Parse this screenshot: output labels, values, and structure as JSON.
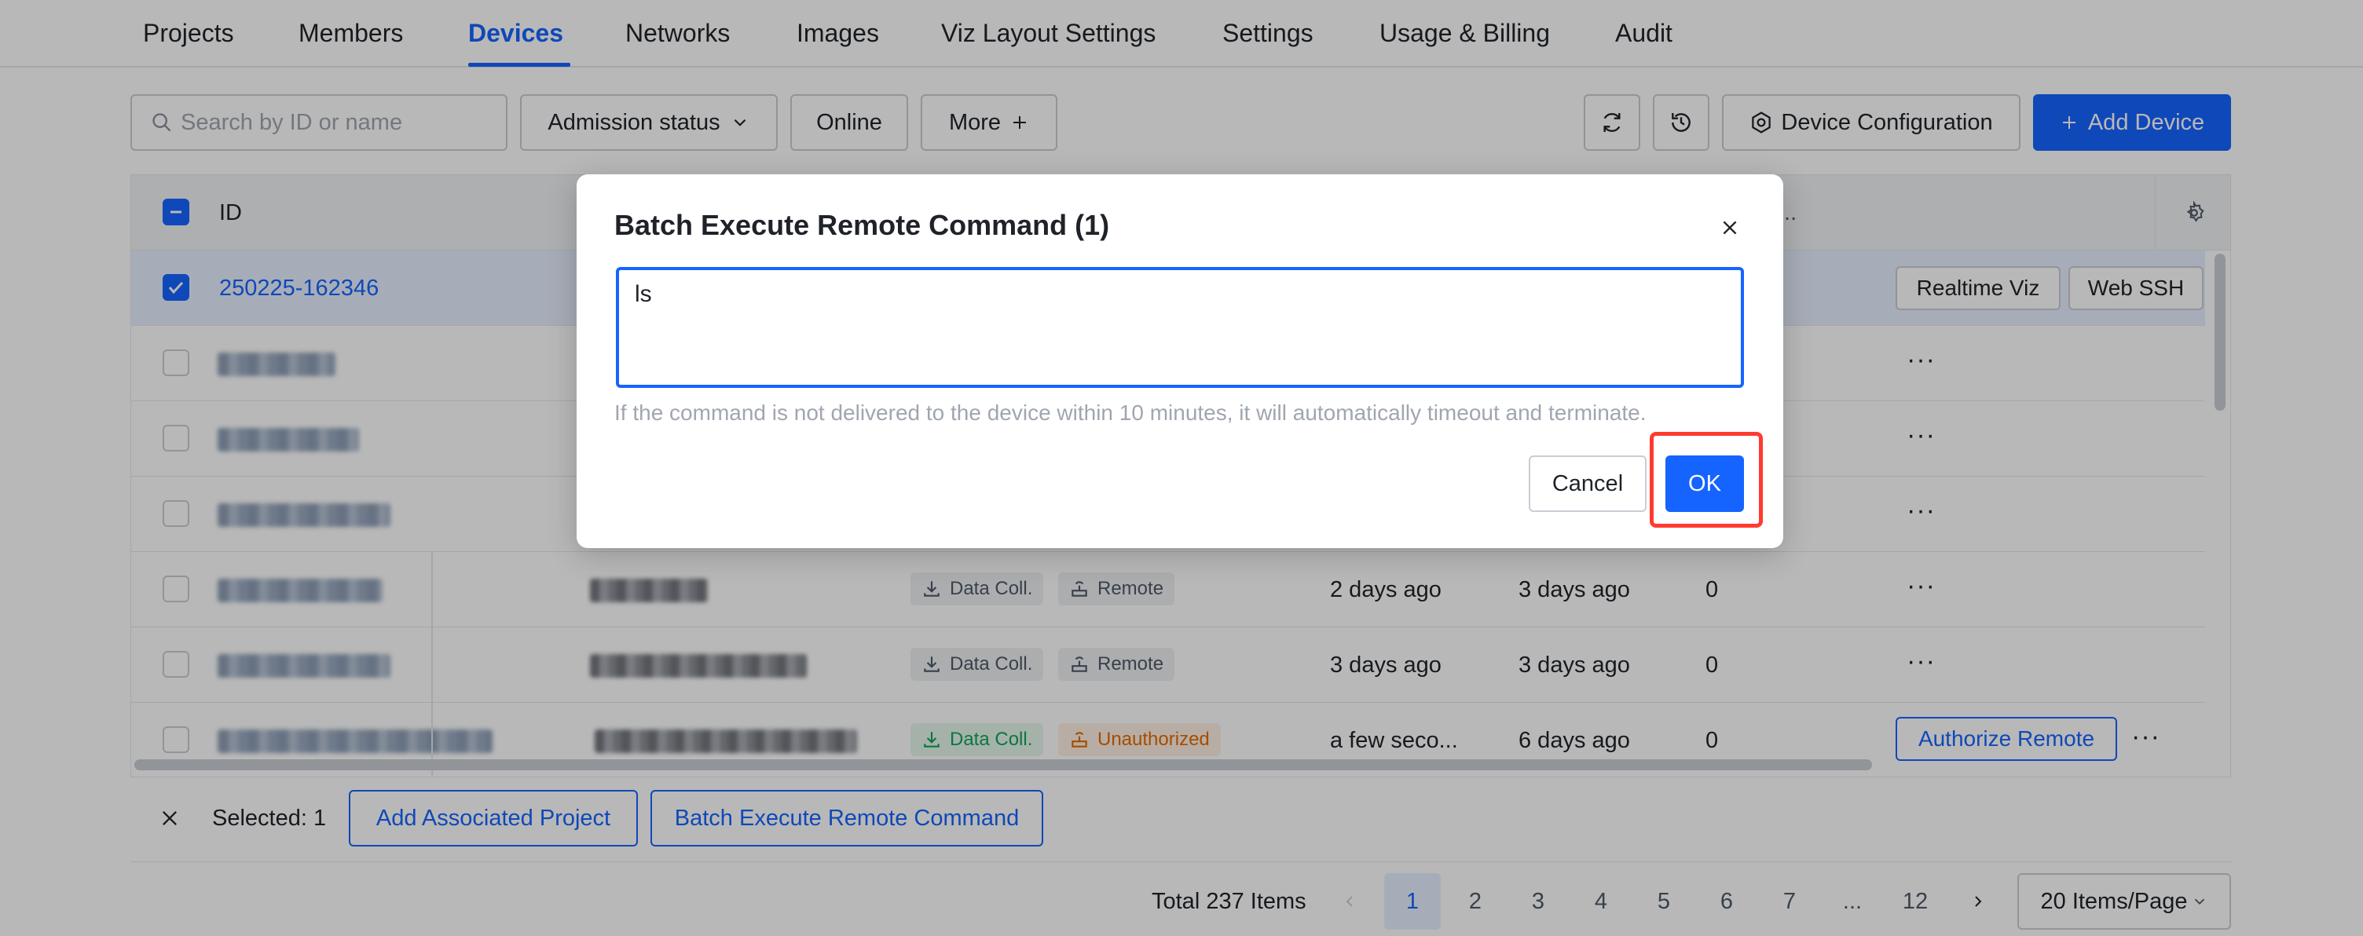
{
  "nav": {
    "tabs": [
      "Projects",
      "Members",
      "Devices",
      "Networks",
      "Images",
      "Viz Layout Settings",
      "Settings",
      "Usage & Billing",
      "Audit"
    ],
    "active_tab": "Devices"
  },
  "toolbar": {
    "search_placeholder": "Search by ID or name",
    "admission_status_label": "Admission status",
    "online_label": "Online",
    "more_label": "More",
    "device_configuration_label": "Device Configuration",
    "add_device_label": "Add Device"
  },
  "table": {
    "id_header": "ID",
    "ellipsis_header": "...",
    "selected_row": {
      "id": "250225-162346",
      "actions": [
        "Realtime Viz",
        "Web SSH"
      ]
    },
    "rows": [
      {
        "tags": [],
        "last_seen": "",
        "created": "",
        "count": ""
      },
      {
        "tags": [],
        "last_seen": "",
        "created": "",
        "count": ""
      },
      {
        "tags": [],
        "last_seen": "",
        "created": "",
        "count": ""
      },
      {
        "tags": [
          {
            "label": "Data Coll.",
            "style": "gray"
          },
          {
            "label": "Remote",
            "style": "gray"
          }
        ],
        "last_seen": "2 days ago",
        "created": "3 days ago",
        "count": "0"
      },
      {
        "tags": [
          {
            "label": "Data Coll.",
            "style": "gray"
          },
          {
            "label": "Remote",
            "style": "gray"
          }
        ],
        "last_seen": "3 days ago",
        "created": "3 days ago",
        "count": "0"
      },
      {
        "tags": [
          {
            "label": "Data Coll.",
            "style": "green"
          },
          {
            "label": "Unauthorized",
            "style": "orange"
          }
        ],
        "last_seen": "a few seco...",
        "created": "6 days ago",
        "count": "0",
        "action": "Authorize Remote"
      }
    ]
  },
  "bottom_bar": {
    "selected_text": "Selected: 1",
    "add_project_label": "Add Associated Project",
    "batch_command_label": "Batch Execute Remote Command"
  },
  "pagination": {
    "total_text": "Total 237 Items",
    "pages": [
      "1",
      "2",
      "3",
      "4",
      "5",
      "6",
      "7",
      "...",
      "12"
    ],
    "current_page": "1",
    "page_size_label": "20 Items/Page"
  },
  "modal": {
    "title": "Batch Execute Remote Command (1)",
    "command_value": "ls",
    "hint": "If the command is not delivered to the device within 10 minutes, it will automatically timeout and terminate.",
    "cancel_label": "Cancel",
    "ok_label": "OK"
  },
  "colors": {
    "primary": "#1664ff",
    "highlight": "#ff3b30",
    "tag_green": "#14a35a",
    "tag_orange": "#e36b00"
  }
}
